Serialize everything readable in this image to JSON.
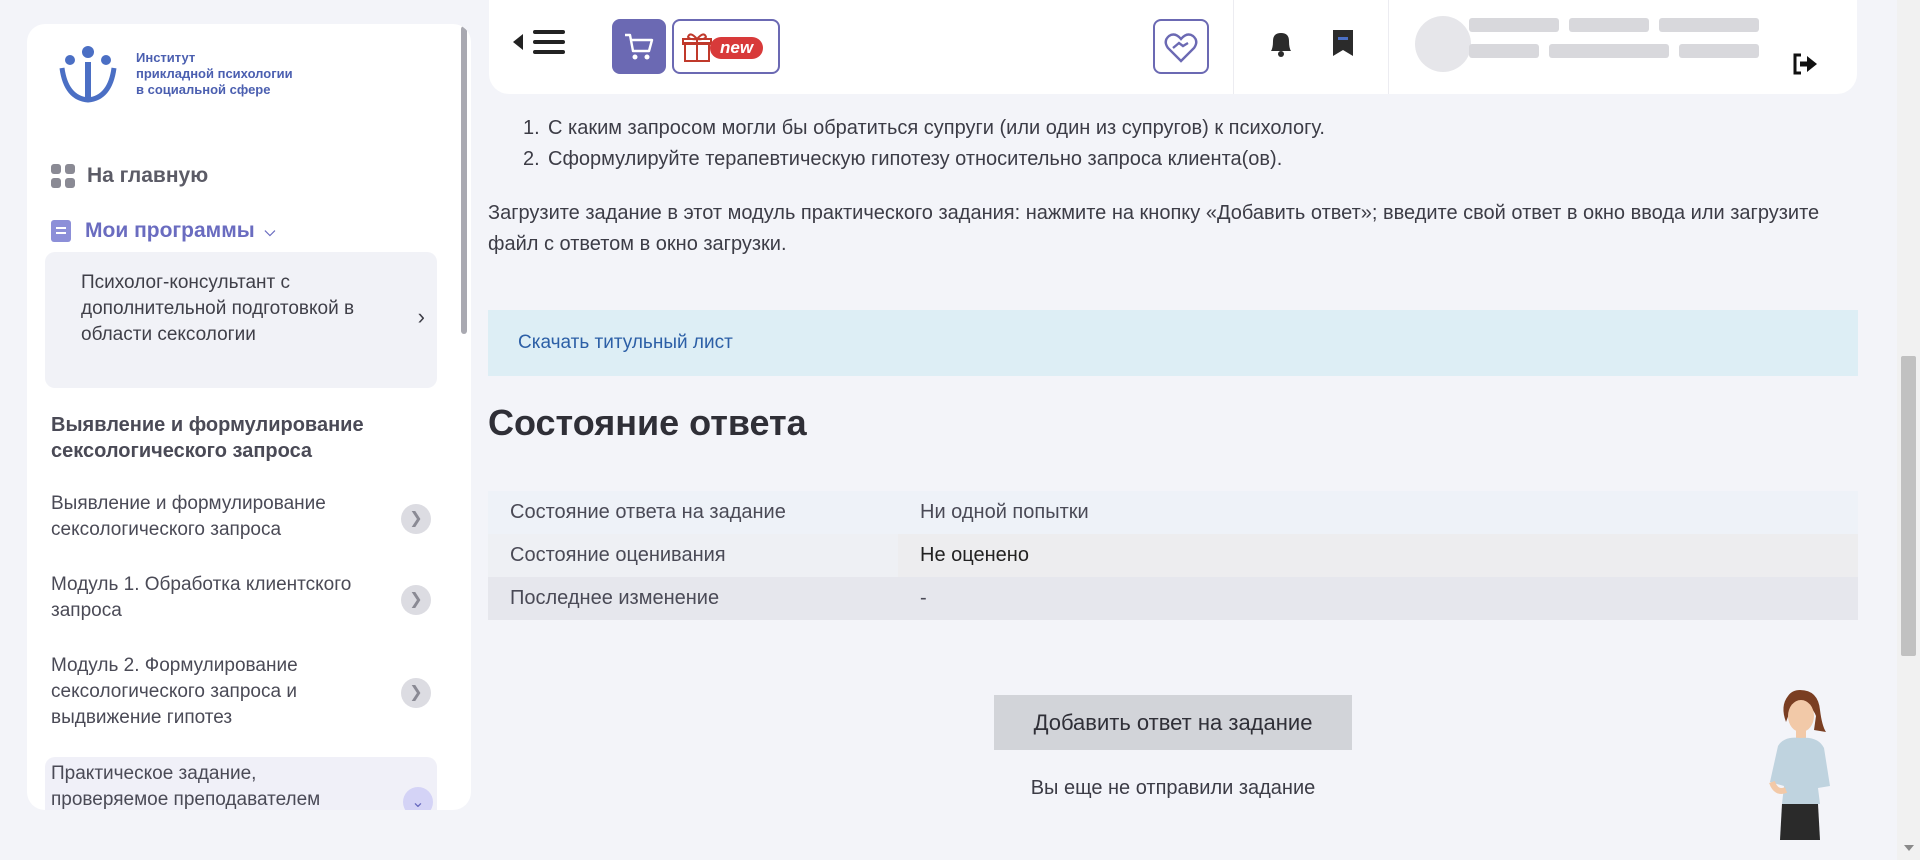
{
  "sidebar": {
    "logo_lines": [
      "Институт",
      "прикладной психологии",
      "в социальной сфере"
    ],
    "home_label": "На главную",
    "programs_label": "Мои программы",
    "program_title": "Психолог-консультант с дополнительной подготовкой в области сексологии",
    "section_title": "Выявление и формулирование сексологического запроса",
    "items": [
      {
        "label": "Выявление и формулирование сексологического запроса"
      },
      {
        "label": "Модуль 1. Обработка клиентского запроса"
      },
      {
        "label": "Модуль 2. Формулирование сексологического запроса и выдвижение гипотез"
      },
      {
        "label": "Практическое задание, проверяемое преподавателем"
      }
    ]
  },
  "header": {
    "gift_badge": "new",
    "icons": [
      "collapse-sidebar-icon",
      "hamburger-icon",
      "cart-icon",
      "gift-icon",
      "handshake-heart-icon",
      "bell-icon",
      "bookmark-icon",
      "logout-icon"
    ]
  },
  "content": {
    "questions": [
      {
        "num": "1.",
        "text": "С каким запросом могли бы обратиться супруги (или один из супругов) к психологу."
      },
      {
        "num": "2.",
        "text": "Сформулируйте терапевтическую гипотезу относительно запроса клиента(ов)."
      }
    ],
    "instructions": "Загрузите задание в этот модуль практического задания: нажмите на кнопку «Добавить ответ»; введите свой ответ в окно ввода или загрузите файл с ответом в окно загрузки.",
    "download_link": "Скачать титульный лист",
    "status_title": "Состояние ответа",
    "status_rows": [
      {
        "label": "Состояние ответа на задание",
        "value": "Ни одной попытки"
      },
      {
        "label": "Состояние оценивания",
        "value": "Не оценено"
      },
      {
        "label": "Последнее изменение",
        "value": "-"
      }
    ],
    "add_button": "Добавить ответ на задание",
    "not_sent": "Вы еще не отправили задание"
  },
  "colors": {
    "accent": "#6b69b3",
    "banner": "#ddeef5",
    "link": "#2c5fa6",
    "badge": "#d83a3a"
  }
}
